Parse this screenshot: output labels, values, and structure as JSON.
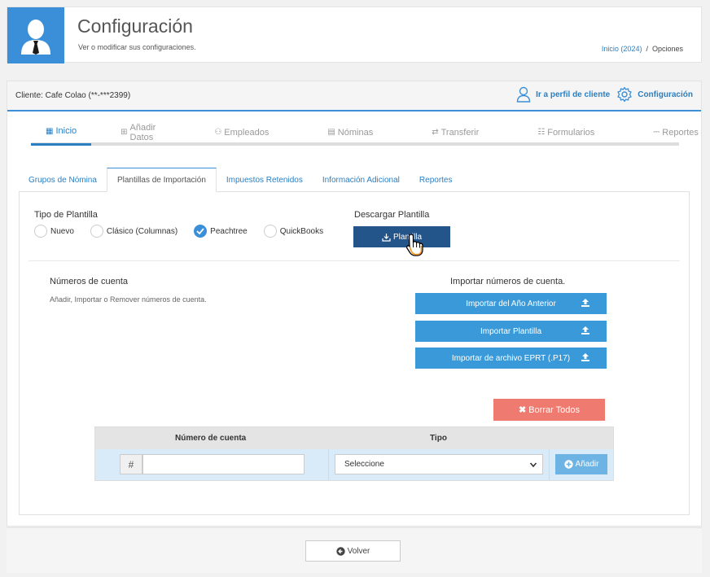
{
  "header": {
    "title": "Configuración",
    "subtitle": "Ver o modificar sus configuraciones.",
    "breadcrumb_link": "Inicio (2024)",
    "breadcrumb_sep": "/",
    "breadcrumb_current": "Opciones"
  },
  "client_bar": {
    "client_label": "Cliente: Cafe Colao (**-***2399)",
    "profile_link": "Ir a perfil de cliente",
    "config_link": "Configuración"
  },
  "top_nav": {
    "items": [
      {
        "label": "Inicio",
        "icon": "grid-icon"
      },
      {
        "label": "Añadir Datos",
        "icon": "plus-square-icon"
      },
      {
        "label": "Empleados",
        "icon": "users-icon"
      },
      {
        "label": "Nóminas",
        "icon": "money-icon"
      },
      {
        "label": "Transferir",
        "icon": "exchange-icon"
      },
      {
        "label": "Formularios",
        "icon": "file-icon"
      },
      {
        "label": "Reportes",
        "icon": "clipboard-icon"
      }
    ]
  },
  "sub_tabs": {
    "items": [
      {
        "label": "Grupos de Nómina"
      },
      {
        "label": "Plantillas de Importación"
      },
      {
        "label": "Impuestos Retenidos"
      },
      {
        "label": "Información Adicional"
      },
      {
        "label": "Reportes"
      }
    ]
  },
  "template": {
    "type_title": "Tipo de Plantilla",
    "options": [
      {
        "label": "Nuevo",
        "checked": false
      },
      {
        "label": "Clásico (Columnas)",
        "checked": false
      },
      {
        "label": "Peachtree",
        "checked": true
      },
      {
        "label": "QuickBooks",
        "checked": false
      }
    ],
    "download_title": "Descargar Plantilla",
    "download_button": "Plantilla"
  },
  "accounts": {
    "title": "Números de cuenta",
    "description": "Añadir, Importar o Remover números de cuenta.",
    "import_title": "Importar números de cuenta.",
    "import_buttons": [
      {
        "label": "Importar del Año Anterior"
      },
      {
        "label": "Importar Plantilla"
      },
      {
        "label": "Importar de archivo EPRT (.P17)"
      }
    ],
    "delete_all_button": "Borrar Todos",
    "table": {
      "col_account": "Número de cuenta",
      "col_type": "Tipo",
      "hash": "#",
      "account_value": "",
      "type_selected": "Seleccione",
      "add_button": "Añadir"
    }
  },
  "footer": {
    "back_button": "Volver"
  },
  "colors": {
    "primary": "#3a8fd8",
    "dark_button": "#24558a",
    "danger": "#ef7b70",
    "add_button": "#6db3e3"
  }
}
